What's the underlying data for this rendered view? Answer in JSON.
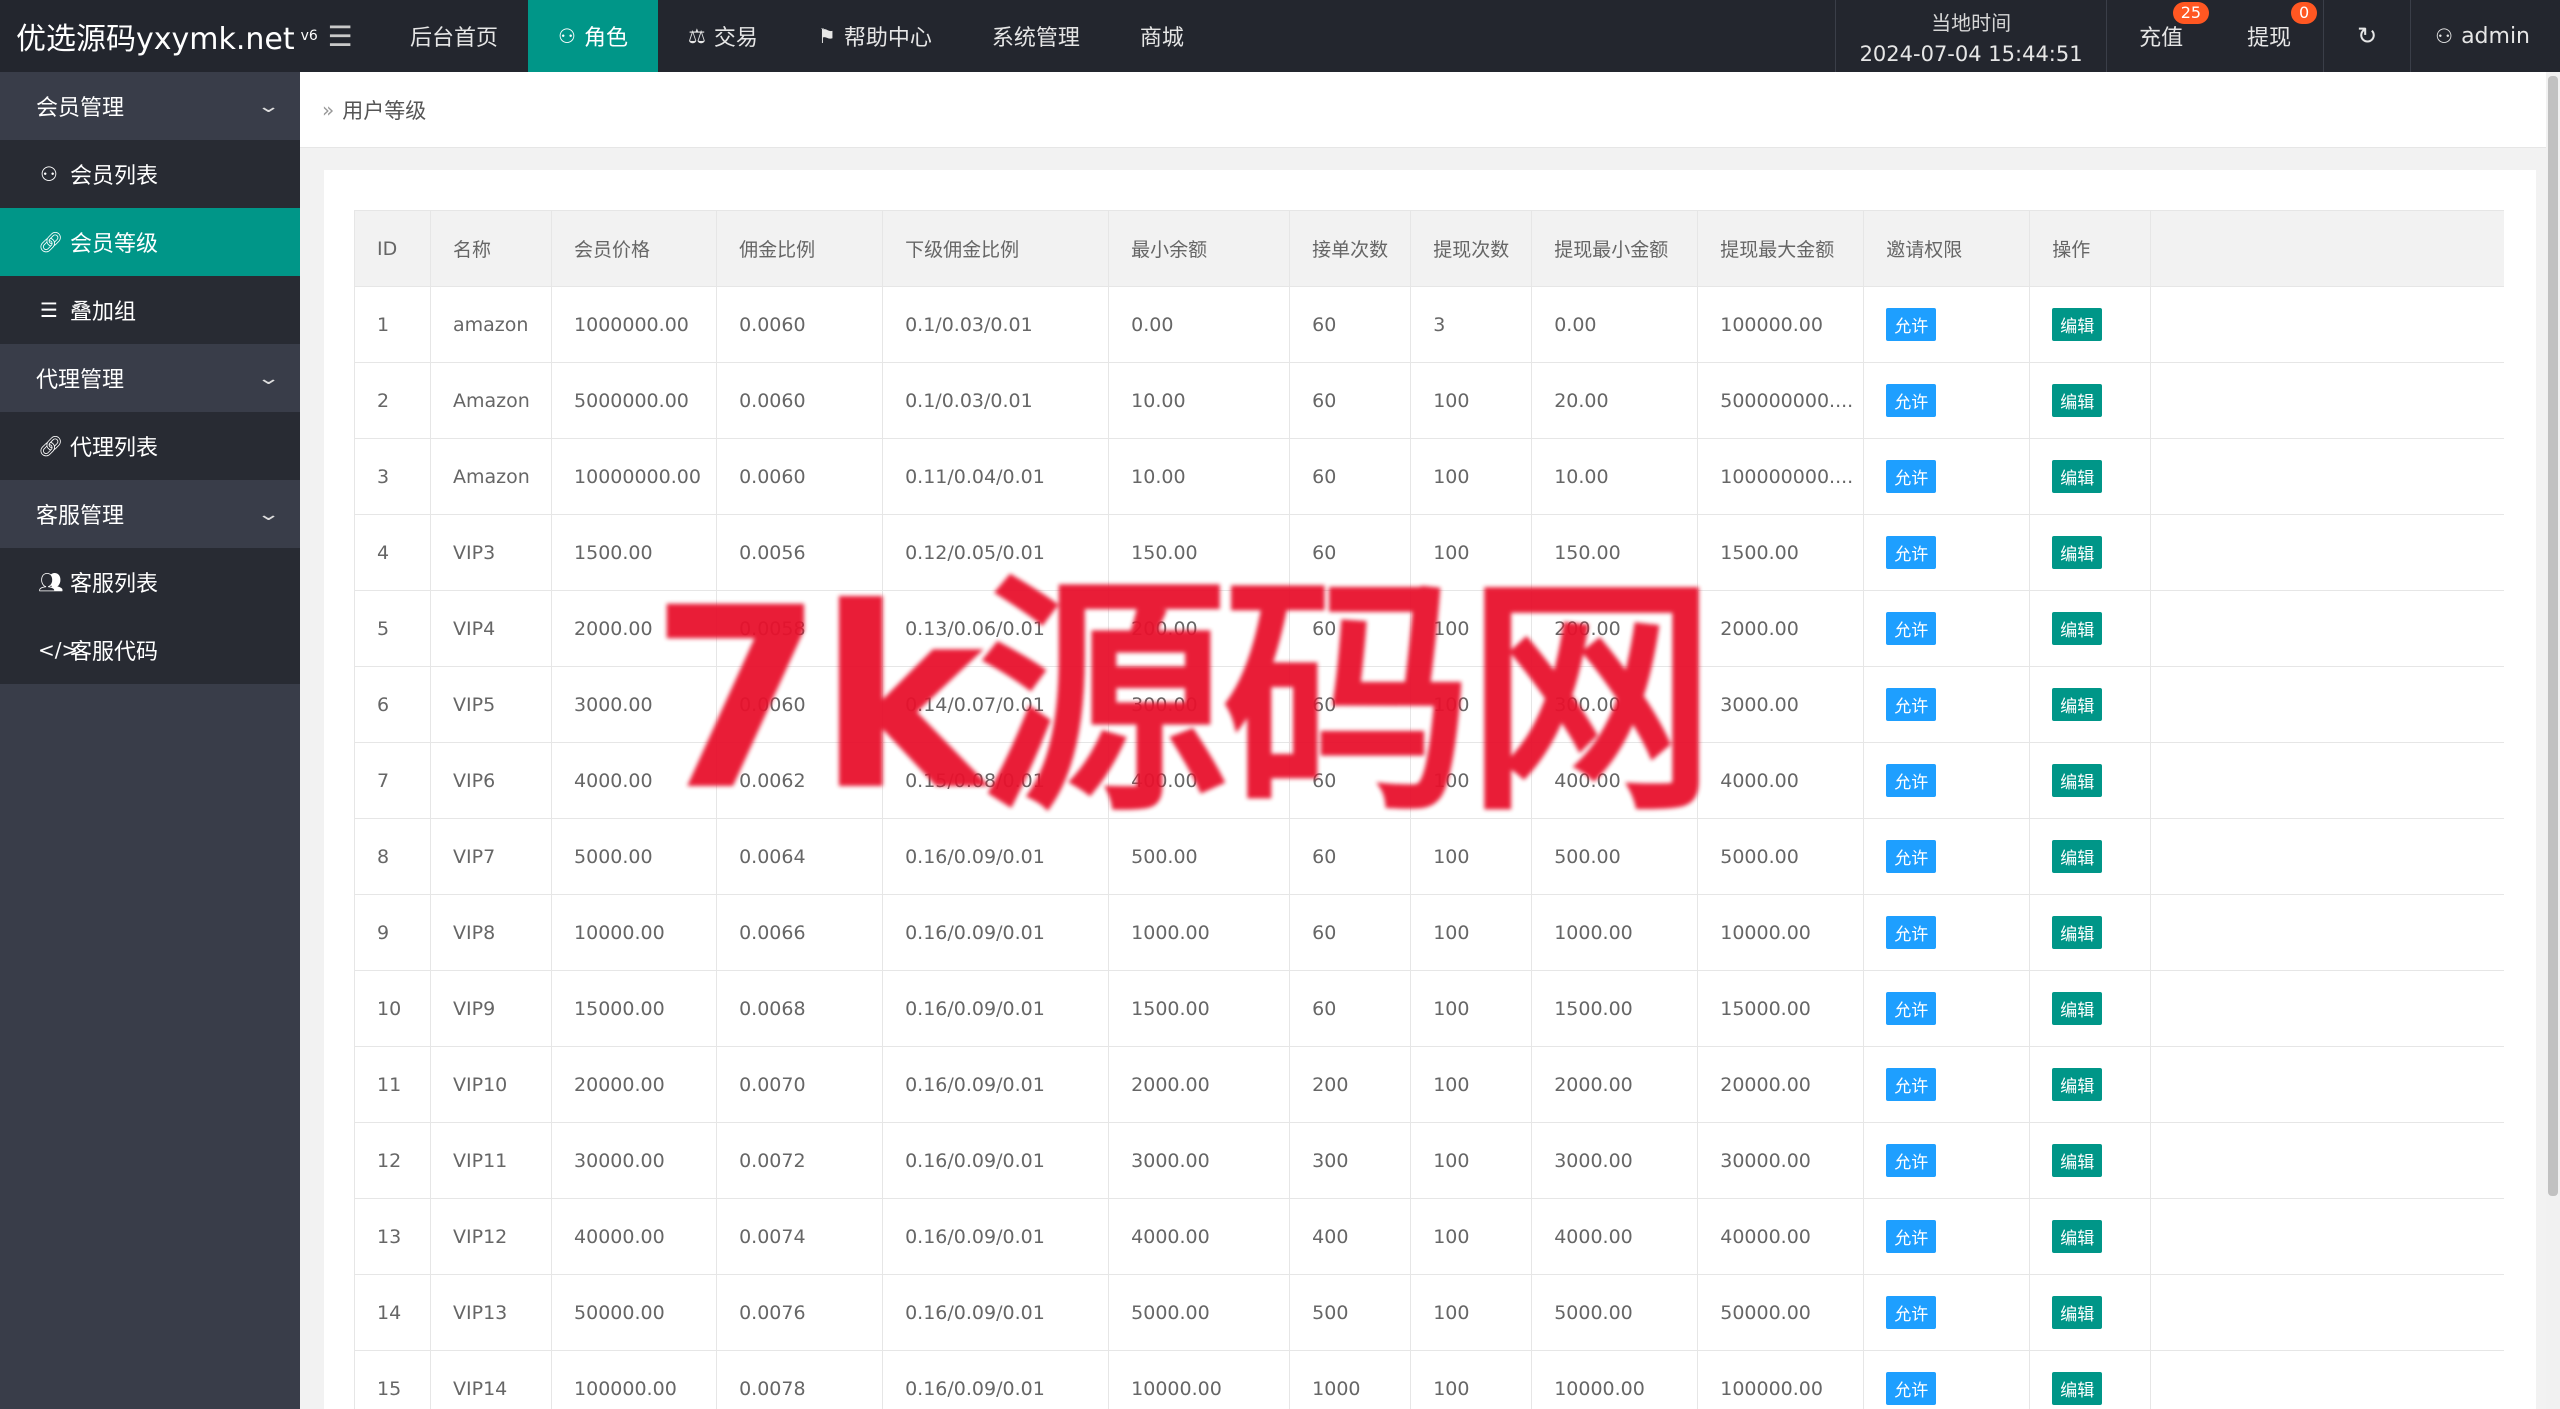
{
  "logo": {
    "text": "优选源码yxymk.net",
    "version": "v6"
  },
  "topnav": {
    "toggle_icon": "menu-icon",
    "items": [
      {
        "label": "后台首页",
        "icon": ""
      },
      {
        "label": "角色",
        "icon": "user-icon",
        "active": true
      },
      {
        "label": "交易",
        "icon": "scale-icon"
      },
      {
        "label": "帮助中心",
        "icon": "flag-icon"
      },
      {
        "label": "系统管理",
        "icon": ""
      },
      {
        "label": "商城",
        "icon": ""
      }
    ]
  },
  "header_right": {
    "clock_label": "当地时间",
    "clock_value": "2024-07-04 15:44:51",
    "recharge_label": "充值",
    "recharge_badge": "25",
    "withdraw_label": "提现",
    "withdraw_badge": "0",
    "refresh_icon": "refresh-icon",
    "user_label": "admin"
  },
  "sidebar": {
    "member_group": "会员管理",
    "member_list": "会员列表",
    "member_level": "会员等级",
    "stack_group": "叠加组",
    "agent_group": "代理管理",
    "agent_list": "代理列表",
    "cs_group": "客服管理",
    "cs_list": "客服列表",
    "cs_code": "客服代码"
  },
  "breadcrumb": {
    "current": "用户等级"
  },
  "table": {
    "headers": [
      "ID",
      "名称",
      "会员价格",
      "佣金比例",
      "下级佣金比例",
      "最小余额",
      "接单次数",
      "提现次数",
      "提现最小金额",
      "提现最大金额",
      "邀请权限",
      "操作"
    ],
    "allow_label": "允许",
    "edit_label": "编辑",
    "rows": [
      [
        "1",
        "amazon",
        "1000000.00",
        "0.0060",
        "0.1/0.03/0.01",
        "0.00",
        "60",
        "3",
        "0.00",
        "100000.00"
      ],
      [
        "2",
        "Amazon",
        "5000000.00",
        "0.0060",
        "0.1/0.03/0.01",
        "10.00",
        "60",
        "100",
        "20.00",
        "500000000...."
      ],
      [
        "3",
        "Amazon",
        "10000000.00",
        "0.0060",
        "0.11/0.04/0.01",
        "10.00",
        "60",
        "100",
        "10.00",
        "100000000...."
      ],
      [
        "4",
        "VIP3",
        "1500.00",
        "0.0056",
        "0.12/0.05/0.01",
        "150.00",
        "60",
        "100",
        "150.00",
        "1500.00"
      ],
      [
        "5",
        "VIP4",
        "2000.00",
        "0.0058",
        "0.13/0.06/0.01",
        "200.00",
        "60",
        "100",
        "200.00",
        "2000.00"
      ],
      [
        "6",
        "VIP5",
        "3000.00",
        "0.0060",
        "0.14/0.07/0.01",
        "300.00",
        "60",
        "100",
        "300.00",
        "3000.00"
      ],
      [
        "7",
        "VIP6",
        "4000.00",
        "0.0062",
        "0.15/0.08/0.01",
        "400.00",
        "60",
        "100",
        "400.00",
        "4000.00"
      ],
      [
        "8",
        "VIP7",
        "5000.00",
        "0.0064",
        "0.16/0.09/0.01",
        "500.00",
        "60",
        "100",
        "500.00",
        "5000.00"
      ],
      [
        "9",
        "VIP8",
        "10000.00",
        "0.0066",
        "0.16/0.09/0.01",
        "1000.00",
        "60",
        "100",
        "1000.00",
        "10000.00"
      ],
      [
        "10",
        "VIP9",
        "15000.00",
        "0.0068",
        "0.16/0.09/0.01",
        "1500.00",
        "60",
        "100",
        "1500.00",
        "15000.00"
      ],
      [
        "11",
        "VIP10",
        "20000.00",
        "0.0070",
        "0.16/0.09/0.01",
        "2000.00",
        "200",
        "100",
        "2000.00",
        "20000.00"
      ],
      [
        "12",
        "VIP11",
        "30000.00",
        "0.0072",
        "0.16/0.09/0.01",
        "3000.00",
        "300",
        "100",
        "3000.00",
        "30000.00"
      ],
      [
        "13",
        "VIP12",
        "40000.00",
        "0.0074",
        "0.16/0.09/0.01",
        "4000.00",
        "400",
        "100",
        "4000.00",
        "40000.00"
      ],
      [
        "14",
        "VIP13",
        "50000.00",
        "0.0076",
        "0.16/0.09/0.01",
        "5000.00",
        "500",
        "100",
        "5000.00",
        "50000.00"
      ],
      [
        "15",
        "VIP14",
        "100000.00",
        "0.0078",
        "0.16/0.09/0.01",
        "10000.00",
        "1000",
        "100",
        "10000.00",
        "100000.00"
      ]
    ]
  },
  "watermark": "7k源码网",
  "colors": {
    "accent": "#009688",
    "allow": "#1e9fff",
    "badge": "#ff5722",
    "sidebar": "#393d49",
    "topbar": "#23262e",
    "watermark": "#e8112d"
  }
}
